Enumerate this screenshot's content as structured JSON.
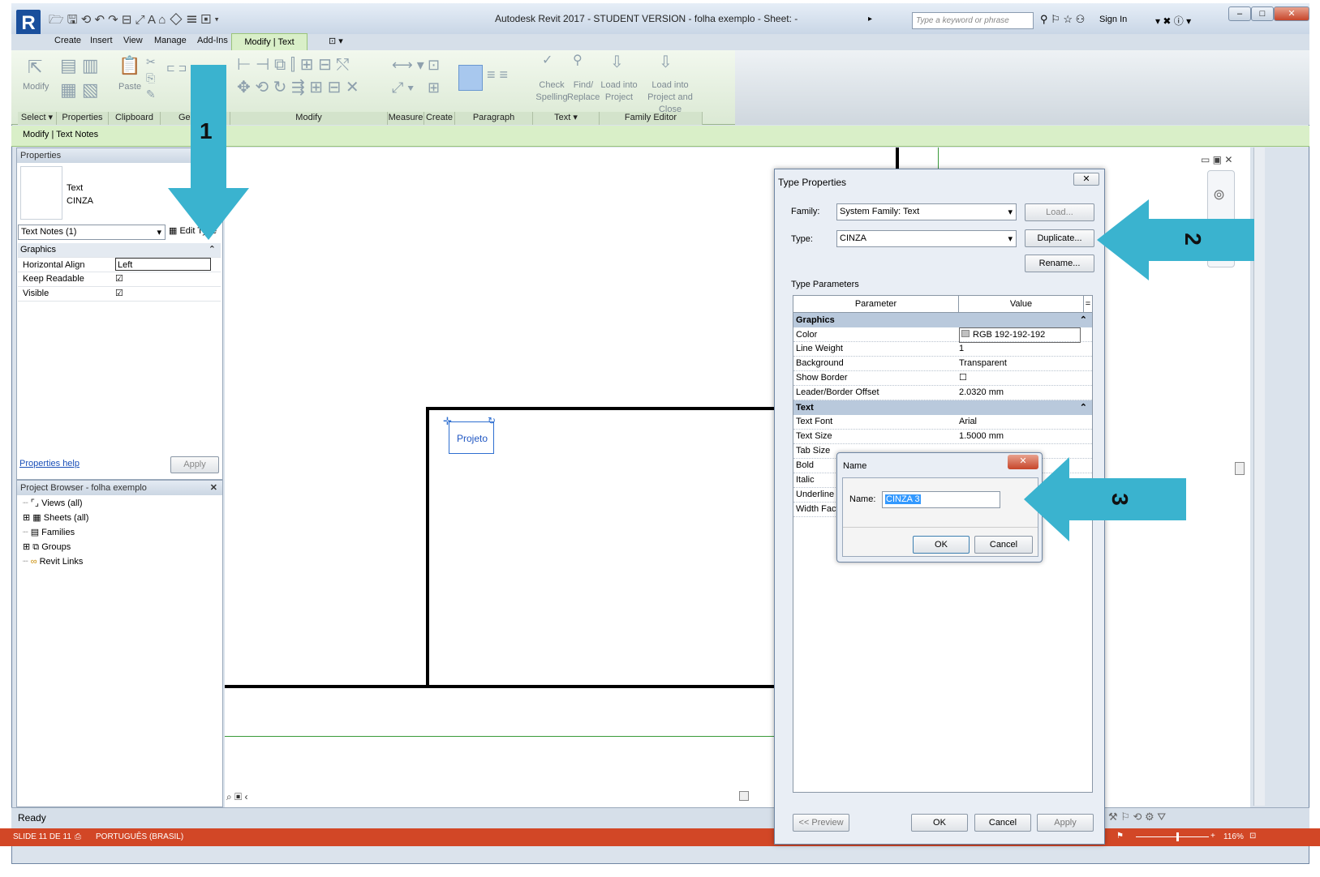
{
  "app": {
    "title": "Autodesk Revit 2017 - STUDENT VERSION -     folha exemplo - Sheet: -",
    "search_placeholder": "Type a keyword or phrase",
    "sign_in": "Sign In"
  },
  "tabs": [
    "Create",
    "Insert",
    "View",
    "Manage",
    "Add-Ins",
    "Modify | Text Notes"
  ],
  "ribbon": {
    "panels": [
      "Select ▾",
      "Properties",
      "Clipboard",
      "Ge",
      "Modify",
      "Measure",
      "Create",
      "Paragraph",
      "Text ▾",
      "Family Editor"
    ],
    "modify_label": "Modify",
    "paste_label": "Paste",
    "check_spelling": [
      "Check",
      "Spelling"
    ],
    "find_replace": [
      "Find/",
      "Replace"
    ],
    "load_into_project": [
      "Load into",
      "Project"
    ],
    "load_into_project_close": [
      "Load into",
      "Project and Close"
    ]
  },
  "context_bar": "Modify | Text Notes",
  "properties": {
    "header": "Properties",
    "type_name_line1": "Text",
    "type_name_line2": "CINZA",
    "selector": "Text Notes (1)",
    "edit_type": "Edit Type",
    "group": "Graphics",
    "rows": [
      {
        "name": "Horizontal Align",
        "value": "Left"
      },
      {
        "name": "Keep Readable",
        "value": "☑"
      },
      {
        "name": "Visible",
        "value": "☑"
      }
    ],
    "help_link": "Properties help",
    "apply": "Apply"
  },
  "browser": {
    "header": "Project Browser - folha exemplo",
    "items": [
      "Views (all)",
      "Sheets (all)",
      "Families",
      "Groups",
      "Revit Links"
    ]
  },
  "canvas": {
    "text_note": "Projeto"
  },
  "status": {
    "ready": "Ready"
  },
  "ppt_bar": {
    "slide": "SLIDE 11 DE 11",
    "language": "PORTUGUÊS (BRASIL)",
    "zoom": "116%"
  },
  "type_properties": {
    "title": "Type Properties",
    "family_label": "Family:",
    "family_value": "System Family: Text",
    "type_label": "Type:",
    "type_value": "CINZA",
    "load": "Load...",
    "duplicate": "Duplicate...",
    "rename": "Rename...",
    "type_parameters": "Type Parameters",
    "col_parameter": "Parameter",
    "col_value": "Value",
    "groups": [
      {
        "name": "Graphics",
        "rows": [
          {
            "name": "Color",
            "value": "RGB 192-192-192"
          },
          {
            "name": "Line Weight",
            "value": "1"
          },
          {
            "name": "Background",
            "value": "Transparent"
          },
          {
            "name": "Show Border",
            "value": "☐"
          },
          {
            "name": "Leader/Border Offset",
            "value": "2.0320 mm"
          }
        ]
      },
      {
        "name": "Text",
        "rows": [
          {
            "name": "Text Font",
            "value": "Arial"
          },
          {
            "name": "Text Size",
            "value": "1.5000 mm"
          },
          {
            "name": "Tab Size",
            "value": ""
          },
          {
            "name": "Bold",
            "value": ""
          },
          {
            "name": "Italic",
            "value": ""
          },
          {
            "name": "Underline",
            "value": ""
          },
          {
            "name": "Width Facto",
            "value": ""
          }
        ]
      }
    ],
    "preview": "<< Preview",
    "ok": "OK",
    "cancel": "Cancel",
    "apply": "Apply"
  },
  "name_dialog": {
    "title": "Name",
    "label": "Name:",
    "value": "CINZA 3",
    "ok": "OK",
    "cancel": "Cancel"
  },
  "callouts": [
    "1",
    "2",
    "3"
  ],
  "colors": {
    "callout_arrow": "#3ab3cf",
    "ribbon_context": "#d9efc8",
    "ppt_bar": "#d24726"
  }
}
